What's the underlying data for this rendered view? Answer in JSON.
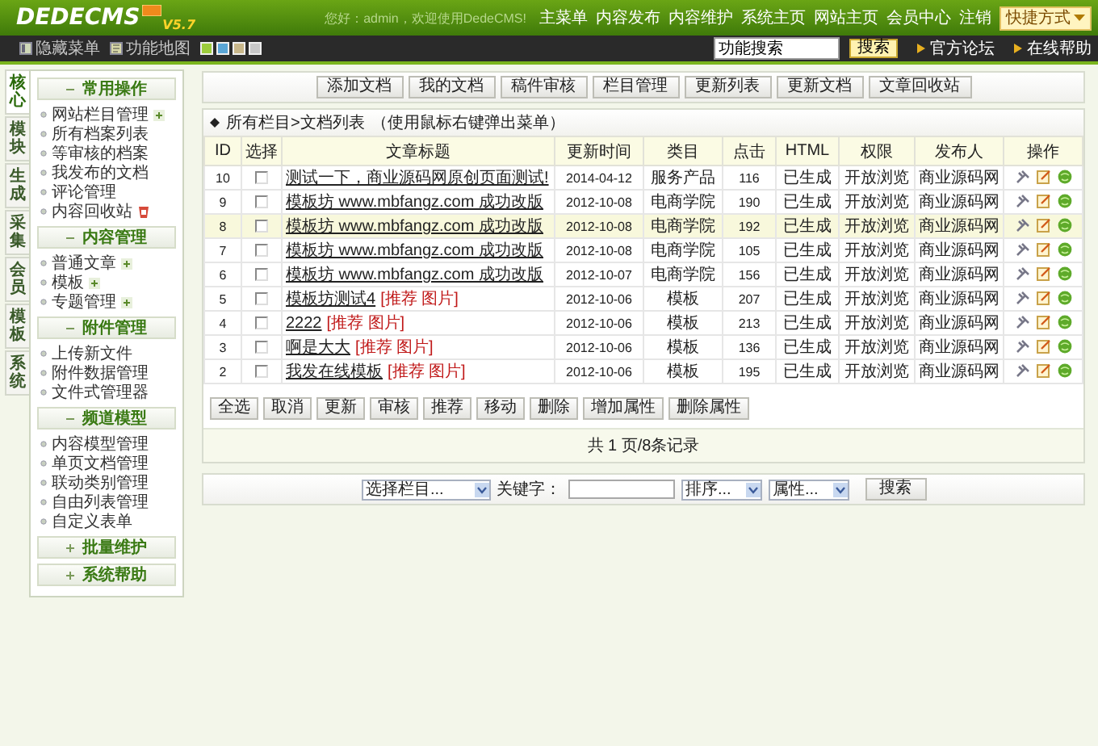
{
  "header": {
    "logo": "DEDECMS",
    "version": "V5.7",
    "greeting": "您好：admin，欢迎使用DedeCMS!",
    "nav": [
      "主菜单",
      "内容发布",
      "内容维护",
      "系统主页",
      "网站主页",
      "会员中心",
      "注销"
    ],
    "shortcut": "快捷方式"
  },
  "subbar": {
    "links": [
      {
        "label": "隐藏菜单",
        "kind": "hide"
      },
      {
        "label": "功能地图",
        "kind": "map"
      }
    ],
    "themes": [
      {
        "color": "#9ccc3c"
      },
      {
        "color": "#5aa6d6"
      },
      {
        "color": "#c8b78a"
      },
      {
        "color": "#c8c8c8"
      }
    ],
    "search": {
      "value": "功能搜索",
      "button": "搜索"
    },
    "help": [
      "官方论坛",
      "在线帮助"
    ]
  },
  "side_tabs": [
    {
      "label": "核心",
      "selected": true
    },
    {
      "label": "模块",
      "selected": false
    },
    {
      "label": "生成",
      "selected": false
    },
    {
      "label": "采集",
      "selected": false
    },
    {
      "label": "会员",
      "selected": false
    },
    {
      "label": "模板",
      "selected": false
    },
    {
      "label": "系统",
      "selected": false
    }
  ],
  "menu": [
    {
      "title": "常用操作",
      "expanded": true,
      "items": [
        {
          "label": "网站栏目管理",
          "kind": "add"
        },
        {
          "label": "所有档案列表",
          "kind": "plain"
        },
        {
          "label": "等审核的档案",
          "kind": "plain"
        },
        {
          "label": "我发布的文档",
          "kind": "plain"
        },
        {
          "label": "评论管理",
          "kind": "plain"
        },
        {
          "label": "内容回收站",
          "kind": "trash"
        }
      ]
    },
    {
      "title": "内容管理",
      "expanded": true,
      "items": [
        {
          "label": "普通文章",
          "kind": "add"
        },
        {
          "label": "模板",
          "kind": "add"
        },
        {
          "label": "专题管理",
          "kind": "add"
        }
      ]
    },
    {
      "title": "附件管理",
      "expanded": true,
      "items": [
        {
          "label": "上传新文件",
          "kind": "plain"
        },
        {
          "label": "附件数据管理",
          "kind": "plain"
        },
        {
          "label": "文件式管理器",
          "kind": "plain"
        }
      ]
    },
    {
      "title": "频道模型",
      "expanded": true,
      "items": [
        {
          "label": "内容模型管理",
          "kind": "plain"
        },
        {
          "label": "单页文档管理",
          "kind": "plain"
        },
        {
          "label": "联动类别管理",
          "kind": "plain"
        },
        {
          "label": "自由列表管理",
          "kind": "plain"
        },
        {
          "label": "自定义表单",
          "kind": "plain"
        }
      ]
    },
    {
      "title": "批量维护",
      "expanded": false
    },
    {
      "title": "系统帮助",
      "expanded": false
    }
  ],
  "toolbar": [
    "添加文档",
    "我的文档",
    "稿件审核",
    "栏目管理",
    "更新列表",
    "更新文档",
    "文章回收站"
  ],
  "list": {
    "title": "所有栏目>文档列表",
    "hint": "（使用鼠标右键弹出菜单）",
    "columns": [
      "ID",
      "选择",
      "文章标题",
      "更新时间",
      "类目",
      "点击",
      "HTML",
      "权限",
      "发布人",
      "操作"
    ],
    "rows": [
      {
        "id": "10",
        "checked": false,
        "highlighted": false,
        "title": "测试一下，商业源码网原创页面测试!",
        "date": "2014-04-12",
        "category": "服务产品",
        "clicks": "116",
        "html": "已生成",
        "access": "开放浏览",
        "publisher": "商业源码网"
      },
      {
        "id": "9",
        "checked": false,
        "highlighted": false,
        "title": "模板坊 www.mbfangz.com 成功改版",
        "date": "2012-10-08",
        "category": "电商学院",
        "clicks": "190",
        "html": "已生成",
        "access": "开放浏览",
        "publisher": "商业源码网"
      },
      {
        "id": "8",
        "checked": false,
        "highlighted": true,
        "title": "模板坊 www.mbfangz.com 成功改版",
        "date": "2012-10-08",
        "category": "电商学院",
        "clicks": "192",
        "html": "已生成",
        "access": "开放浏览",
        "publisher": "商业源码网"
      },
      {
        "id": "7",
        "checked": false,
        "highlighted": false,
        "title": "模板坊 www.mbfangz.com 成功改版",
        "date": "2012-10-08",
        "category": "电商学院",
        "clicks": "105",
        "html": "已生成",
        "access": "开放浏览",
        "publisher": "商业源码网"
      },
      {
        "id": "6",
        "checked": false,
        "highlighted": false,
        "title": "模板坊 www.mbfangz.com 成功改版",
        "date": "2012-10-07",
        "category": "电商学院",
        "clicks": "156",
        "html": "已生成",
        "access": "开放浏览",
        "publisher": "商业源码网"
      },
      {
        "id": "5",
        "checked": false,
        "highlighted": false,
        "title": "模板坊测试4",
        "flags": "[推荐 图片]",
        "date": "2012-10-06",
        "category": "模板",
        "clicks": "207",
        "html": "已生成",
        "access": "开放浏览",
        "publisher": "商业源码网"
      },
      {
        "id": "4",
        "checked": false,
        "highlighted": false,
        "title": "2222",
        "flags": "[推荐 图片]",
        "date": "2012-10-06",
        "category": "模板",
        "clicks": "213",
        "html": "已生成",
        "access": "开放浏览",
        "publisher": "商业源码网"
      },
      {
        "id": "3",
        "checked": false,
        "highlighted": false,
        "title": "啊是大大",
        "flags": "[推荐 图片]",
        "date": "2012-10-06",
        "category": "模板",
        "clicks": "136",
        "html": "已生成",
        "access": "开放浏览",
        "publisher": "商业源码网"
      },
      {
        "id": "2",
        "checked": false,
        "highlighted": false,
        "title": "我发在线模板",
        "flags": "[推荐 图片]",
        "date": "2012-10-06",
        "category": "模板",
        "clicks": "195",
        "html": "已生成",
        "access": "开放浏览",
        "publisher": "商业源码网"
      }
    ],
    "actions": [
      "全选",
      "取消",
      "更新",
      "审核",
      "推荐",
      "移动",
      "删除",
      "增加属性",
      "删除属性"
    ],
    "pagination": "共 1 页/8条记录"
  },
  "filter": {
    "category": "选择栏目...",
    "keyword_label": "关键字：",
    "sort": "排序...",
    "attribute": "属性...",
    "button": "搜索"
  }
}
